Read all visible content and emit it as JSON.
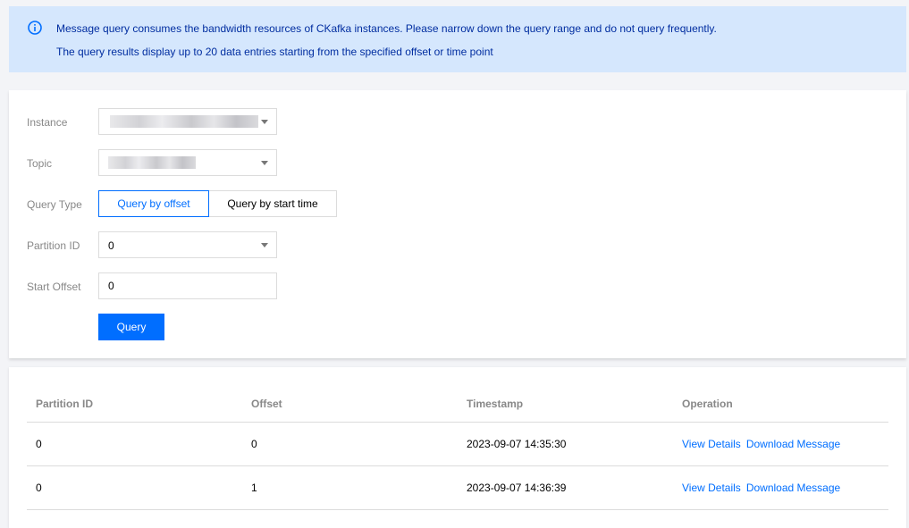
{
  "notice": {
    "line1": "Message query consumes the bandwidth resources of CKafka instances. Please narrow down the query range and do not query frequently.",
    "line2": "The query results display up to 20 data entries starting from the specified offset or time point"
  },
  "form": {
    "instance_label": "Instance",
    "topic_label": "Topic",
    "query_type_label": "Query Type",
    "query_by_offset": "Query by offset",
    "query_by_start_time": "Query by start time",
    "partition_label": "Partition ID",
    "partition_value": "0",
    "start_offset_label": "Start Offset",
    "start_offset_value": "0",
    "query_button": "Query"
  },
  "table": {
    "headers": [
      "Partition ID",
      "Offset",
      "Timestamp",
      "Operation"
    ],
    "rows": [
      {
        "partition": "0",
        "offset": "0",
        "timestamp": "2023-09-07 14:35:30",
        "view": "View Details",
        "download": "Download Message"
      },
      {
        "partition": "0",
        "offset": "1",
        "timestamp": "2023-09-07 14:36:39",
        "view": "View Details",
        "download": "Download Message"
      }
    ]
  },
  "colors": {
    "accent": "#006eff",
    "notice_bg": "#d5e7fd",
    "notice_text": "#002da0"
  }
}
